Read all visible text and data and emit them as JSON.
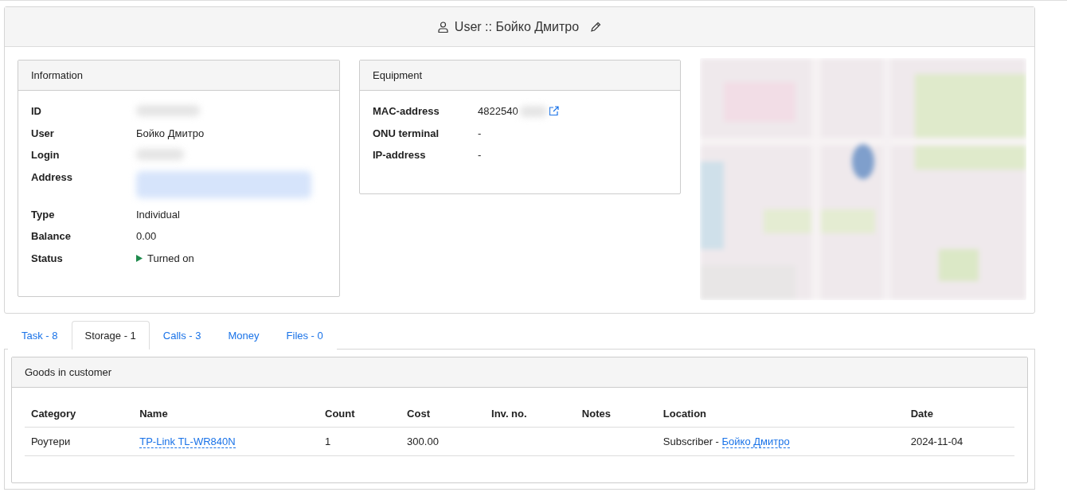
{
  "header": {
    "title": "User :: Бойко Дмитро"
  },
  "information": {
    "title": "Information",
    "rows": [
      {
        "label": "ID",
        "kind": "redacted"
      },
      {
        "label": "User",
        "kind": "text",
        "value": "Бойко Дмитро"
      },
      {
        "label": "Login",
        "kind": "redacted"
      },
      {
        "label": "Address",
        "kind": "redacted_link"
      },
      {
        "label": "Type",
        "kind": "text",
        "value": "Individual"
      },
      {
        "label": "Balance",
        "kind": "text",
        "value": "0.00"
      },
      {
        "label": "Status",
        "kind": "status",
        "value": "Turned on",
        "on": true
      }
    ]
  },
  "equipment": {
    "title": "Equipment",
    "rows": [
      {
        "label": "MAC-address",
        "kind": "mac",
        "value": "4822540"
      },
      {
        "label": "ONU terminal",
        "kind": "text",
        "value": "-"
      },
      {
        "label": "IP-address",
        "kind": "text",
        "value": "-"
      }
    ]
  },
  "tabs": [
    {
      "label": "Task - 8",
      "selected": false
    },
    {
      "label": "Storage - 1",
      "selected": true
    },
    {
      "label": "Calls - 3",
      "selected": false
    },
    {
      "label": "Money",
      "selected": false
    },
    {
      "label": "Files - 0",
      "selected": false
    }
  ],
  "goods": {
    "title": "Goods in customer",
    "columns": [
      "Category",
      "Name",
      "Count",
      "Cost",
      "Inv. no.",
      "Notes",
      "Location",
      "Date"
    ],
    "rows": [
      {
        "category": "Роутери",
        "name": "TP-Link TL-WR840N",
        "count": "1",
        "cost": "300.00",
        "inv_no": "",
        "notes": "",
        "location_prefix": "Subscriber - ",
        "location_link": "Бойко Дмитро",
        "date": "2024-11-04"
      }
    ]
  }
}
